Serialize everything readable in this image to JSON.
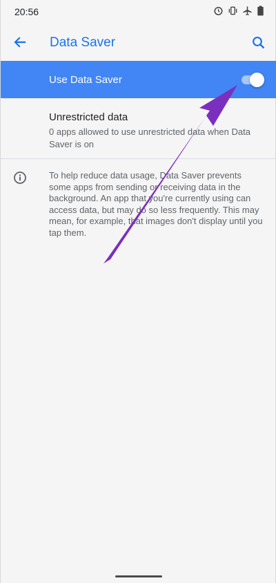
{
  "status_bar": {
    "time": "20:56",
    "icons": [
      "alarm-icon",
      "vibrate-icon",
      "airplane-mode-icon",
      "battery-icon"
    ]
  },
  "app_bar": {
    "title": "Data Saver",
    "back_icon": "arrow-back-icon",
    "search_icon": "search-icon"
  },
  "toggle": {
    "label": "Use Data Saver",
    "enabled": true
  },
  "unrestricted": {
    "title": "Unrestricted data",
    "subtitle": "0 apps allowed to use unrestricted data when Data Saver is on"
  },
  "info": {
    "icon": "info-icon",
    "text": "To help reduce data usage, Data Saver prevents some apps from sending or receiving data in the background. An app that you're currently using can access data, but may do so less frequently. This may mean, for example, that images don't display until you tap them."
  },
  "colors": {
    "accent": "#1a73e8",
    "toggle_row_bg": "#4285f4",
    "annotation_arrow": "#7b2fbf"
  }
}
